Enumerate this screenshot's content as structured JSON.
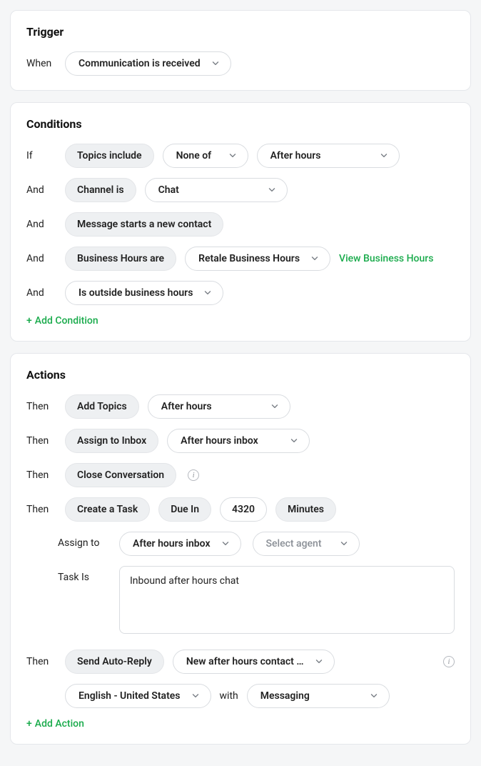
{
  "trigger": {
    "title": "Trigger",
    "when_label": "When",
    "event": "Communication is received"
  },
  "conditions": {
    "title": "Conditions",
    "if_label": "If",
    "and_label": "And",
    "rows": [
      {
        "chip": "Topics include",
        "op": "None of",
        "value": "After hours"
      },
      {
        "chip": "Channel is",
        "value": "Chat"
      },
      {
        "chip": "Message starts a new contact"
      },
      {
        "chip": "Business Hours are",
        "value": "Retale Business Hours",
        "link": "View Business Hours"
      },
      {
        "chip_select": "Is outside business hours"
      }
    ],
    "add_label": "Add Condition"
  },
  "actions": {
    "title": "Actions",
    "then_label": "Then",
    "rows": {
      "r1": {
        "chip": "Add Topics",
        "value": "After hours"
      },
      "r2": {
        "chip": "Assign to Inbox",
        "value": "After hours inbox"
      },
      "r3": {
        "chip": "Close Conversation"
      },
      "r4": {
        "chip": "Create a Task",
        "due_chip": "Due In",
        "due_value": "4320",
        "unit_chip": "Minutes",
        "assign_label": "Assign to",
        "assign_inbox": "After hours inbox",
        "assign_agent_placeholder": "Select agent",
        "task_label": "Task Is",
        "task_text": "Inbound after hours chat"
      },
      "r5": {
        "chip": "Send Auto-Reply",
        "template": "New after hours contact …",
        "locale": "English - United States",
        "with_label": "with",
        "channel": "Messaging"
      }
    },
    "add_label": "Add Action"
  }
}
